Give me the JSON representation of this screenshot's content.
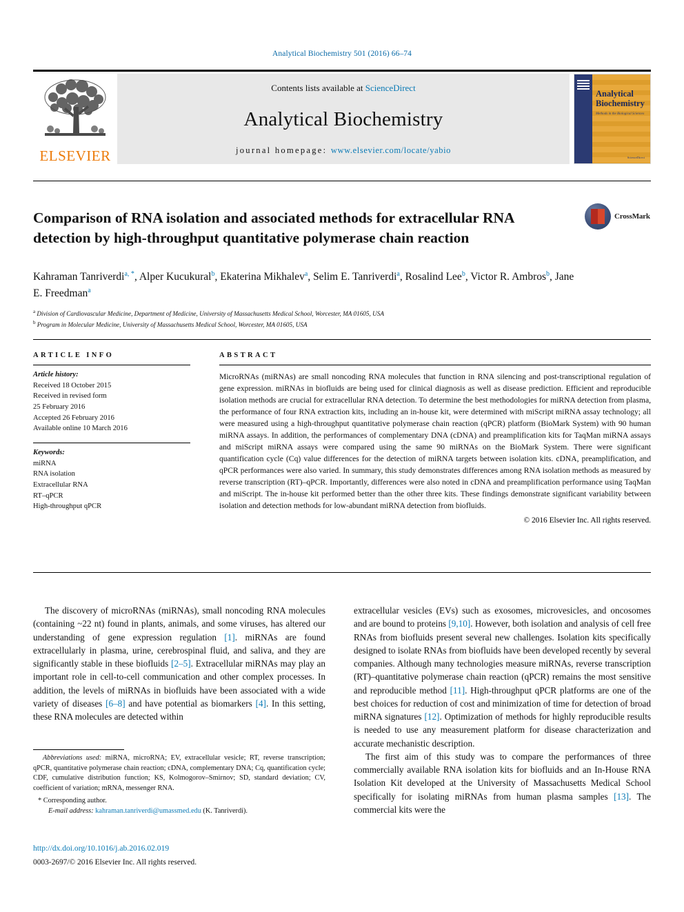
{
  "running_head": "Analytical Biochemistry 501 (2016) 66–74",
  "masthead": {
    "publisher_word": "ELSEVIER",
    "contents_prefix": "Contents lists available at ",
    "contents_link": "ScienceDirect",
    "journal_name": "Analytical Biochemistry",
    "homepage_label": "journal homepage: ",
    "homepage_url": "www.elsevier.com/locate/yabio",
    "cover": {
      "title": "Analytical Biochemistry",
      "subtitle": "Methods in the Biological Sciences",
      "footer": "ScienceDirect"
    }
  },
  "article": {
    "title": "Comparison of RNA isolation and associated methods for extracellular RNA detection by high-throughput quantitative polymerase chain reaction",
    "crossmark_label": "CrossMark",
    "authors": [
      {
        "name": "Kahraman Tanriverdi",
        "marks": "a, *"
      },
      {
        "name": "Alper Kucukural",
        "marks": "b"
      },
      {
        "name": "Ekaterina Mikhalev",
        "marks": "a"
      },
      {
        "name": "Selim E. Tanriverdi",
        "marks": "a"
      },
      {
        "name": "Rosalind Lee",
        "marks": "b"
      },
      {
        "name": "Victor R. Ambros",
        "marks": "b"
      },
      {
        "name": "Jane E. Freedman",
        "marks": "a"
      }
    ],
    "affiliations": [
      {
        "mark": "a",
        "text": "Division of Cardiovascular Medicine, Department of Medicine, University of Massachusetts Medical School, Worcester, MA 01605, USA"
      },
      {
        "mark": "b",
        "text": "Program in Molecular Medicine, University of Massachusetts Medical School, Worcester, MA 01605, USA"
      }
    ]
  },
  "article_info": {
    "heading": "ARTICLE INFO",
    "history_title": "Article history:",
    "history_lines": [
      "Received 18 October 2015",
      "Received in revised form",
      "25 February 2016",
      "Accepted 26 February 2016",
      "Available online 10 March 2016"
    ],
    "keywords_title": "Keywords:",
    "keywords": [
      "miRNA",
      "RNA isolation",
      "Extracellular RNA",
      "RT–qPCR",
      "High-throughput qPCR"
    ]
  },
  "abstract": {
    "heading": "ABSTRACT",
    "text": "MicroRNAs (miRNAs) are small noncoding RNA molecules that function in RNA silencing and post-transcriptional regulation of gene expression. miRNAs in biofluids are being used for clinical diagnosis as well as disease prediction. Efficient and reproducible isolation methods are crucial for extracellular RNA detection. To determine the best methodologies for miRNA detection from plasma, the performance of four RNA extraction kits, including an in-house kit, were determined with miScript miRNA assay technology; all were measured using a high-throughput quantitative polymerase chain reaction (qPCR) platform (BioMark System) with 90 human miRNA assays. In addition, the performances of complementary DNA (cDNA) and preamplification kits for TaqMan miRNA assays and miScript miRNA assays were compared using the same 90 miRNAs on the BioMark System. There were significant quantification cycle (Cq) value differences for the detection of miRNA targets between isolation kits. cDNA, preamplification, and qPCR performances were also varied. In summary, this study demonstrates differences among RNA isolation methods as measured by reverse transcription (RT)–qPCR. Importantly, differences were also noted in cDNA and preamplification performance using TaqMan and miScript. The in-house kit performed better than the other three kits. These findings demonstrate significant variability between isolation and detection methods for low-abundant miRNA detection from biofluids.",
    "copyright": "© 2016 Elsevier Inc. All rights reserved."
  },
  "body": {
    "left_paragraph_1_a": "The discovery of microRNAs (miRNAs), small noncoding RNA molecules (containing ~22 nt) found in plants, animals, and some viruses, has altered our understanding of gene expression regulation ",
    "left_ref_1": "[1]",
    "left_paragraph_1_b": ". miRNAs are found extracellularly in plasma, urine, cerebrospinal fluid, and saliva, and they are significantly stable in these biofluids ",
    "left_ref_2": "[2–5]",
    "left_paragraph_1_c": ". Extracellular miRNAs may play an important role in cell-to-cell communication and other complex processes. In addition, the levels of miRNAs in biofluids have been associated with a wide variety of diseases ",
    "left_ref_3": "[6–8]",
    "left_paragraph_1_d": " and have potential as biomarkers ",
    "left_ref_4": "[4]",
    "left_paragraph_1_e": ". In this setting, these RNA molecules are detected within",
    "right_paragraph_1_a": "extracellular vesicles (EVs) such as exosomes, microvesicles, and oncosomes and are bound to proteins ",
    "right_ref_1": "[9,10]",
    "right_paragraph_1_b": ". However, both isolation and analysis of cell free RNAs from biofluids present several new challenges. Isolation kits specifically designed to isolate RNAs from biofluids have been developed recently by several companies. Although many technologies measure miRNAs, reverse transcription (RT)–quantitative polymerase chain reaction (qPCR) remains the most sensitive and reproducible method ",
    "right_ref_2": "[11]",
    "right_paragraph_1_c": ". High-throughput qPCR platforms are one of the best choices for reduction of cost and minimization of time for detection of broad miRNA signatures ",
    "right_ref_3": "[12]",
    "right_paragraph_1_d": ". Optimization of methods for highly reproducible results is needed to use any measurement platform for disease characterization and accurate mechanistic description.",
    "right_paragraph_2_a": "The first aim of this study was to compare the performances of three commercially available RNA isolation kits for biofluids and an In-House RNA Isolation Kit developed at the University of Massachusetts Medical School specifically for isolating miRNAs from human plasma samples ",
    "right_ref_4": "[13]",
    "right_paragraph_2_b": ". The commercial kits were the"
  },
  "footnotes": {
    "abbrev_title": "Abbreviations used:",
    "abbrev_text": " miRNA, microRNA; EV, extracellular vesicle; RT, reverse transcription; qPCR, quantitative polymerase chain reaction; cDNA, complementary DNA; Cq, quantification cycle; CDF, cumulative distribution function; KS, Kolmogorov–Smirnov; SD, standard deviation; CV, coefficient of variation; mRNA, messenger RNA.",
    "corresponding": "Corresponding author.",
    "email_label": "E-mail address:",
    "email": "kahraman.tanriverdi@umassmed.edu",
    "email_suffix": " (K. Tanriverdi).",
    "doi": "http://dx.doi.org/10.1016/j.ab.2016.02.019",
    "issn": "0003-2697/© 2016 Elsevier Inc. All rights reserved."
  },
  "colors": {
    "link_blue": "#0b7ab5",
    "elsevier_orange": "#ec7a08",
    "cover_navy": "#2b3a72",
    "cover_gold": "#e8a93c"
  }
}
